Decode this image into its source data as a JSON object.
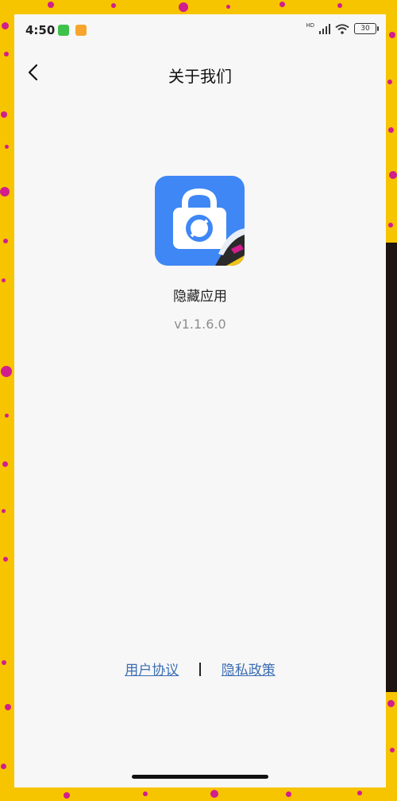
{
  "status_bar": {
    "time": "4:50",
    "network_label": "HD",
    "battery": "30",
    "notification_icons": [
      "wechat-icon",
      "app-notification-icon"
    ]
  },
  "header": {
    "title": "关于我们"
  },
  "app": {
    "name": "隐藏应用",
    "version": "v1.1.6.0"
  },
  "footer": {
    "user_agreement": "用户协议",
    "separator": "|",
    "privacy_policy": "隐私政策"
  },
  "colors": {
    "accent_link": "#3C6EB3",
    "app_icon": "#3F87F5",
    "background": "#F7F7F7",
    "frame": "#F7C400",
    "frame_dots": "#D11D8E"
  }
}
